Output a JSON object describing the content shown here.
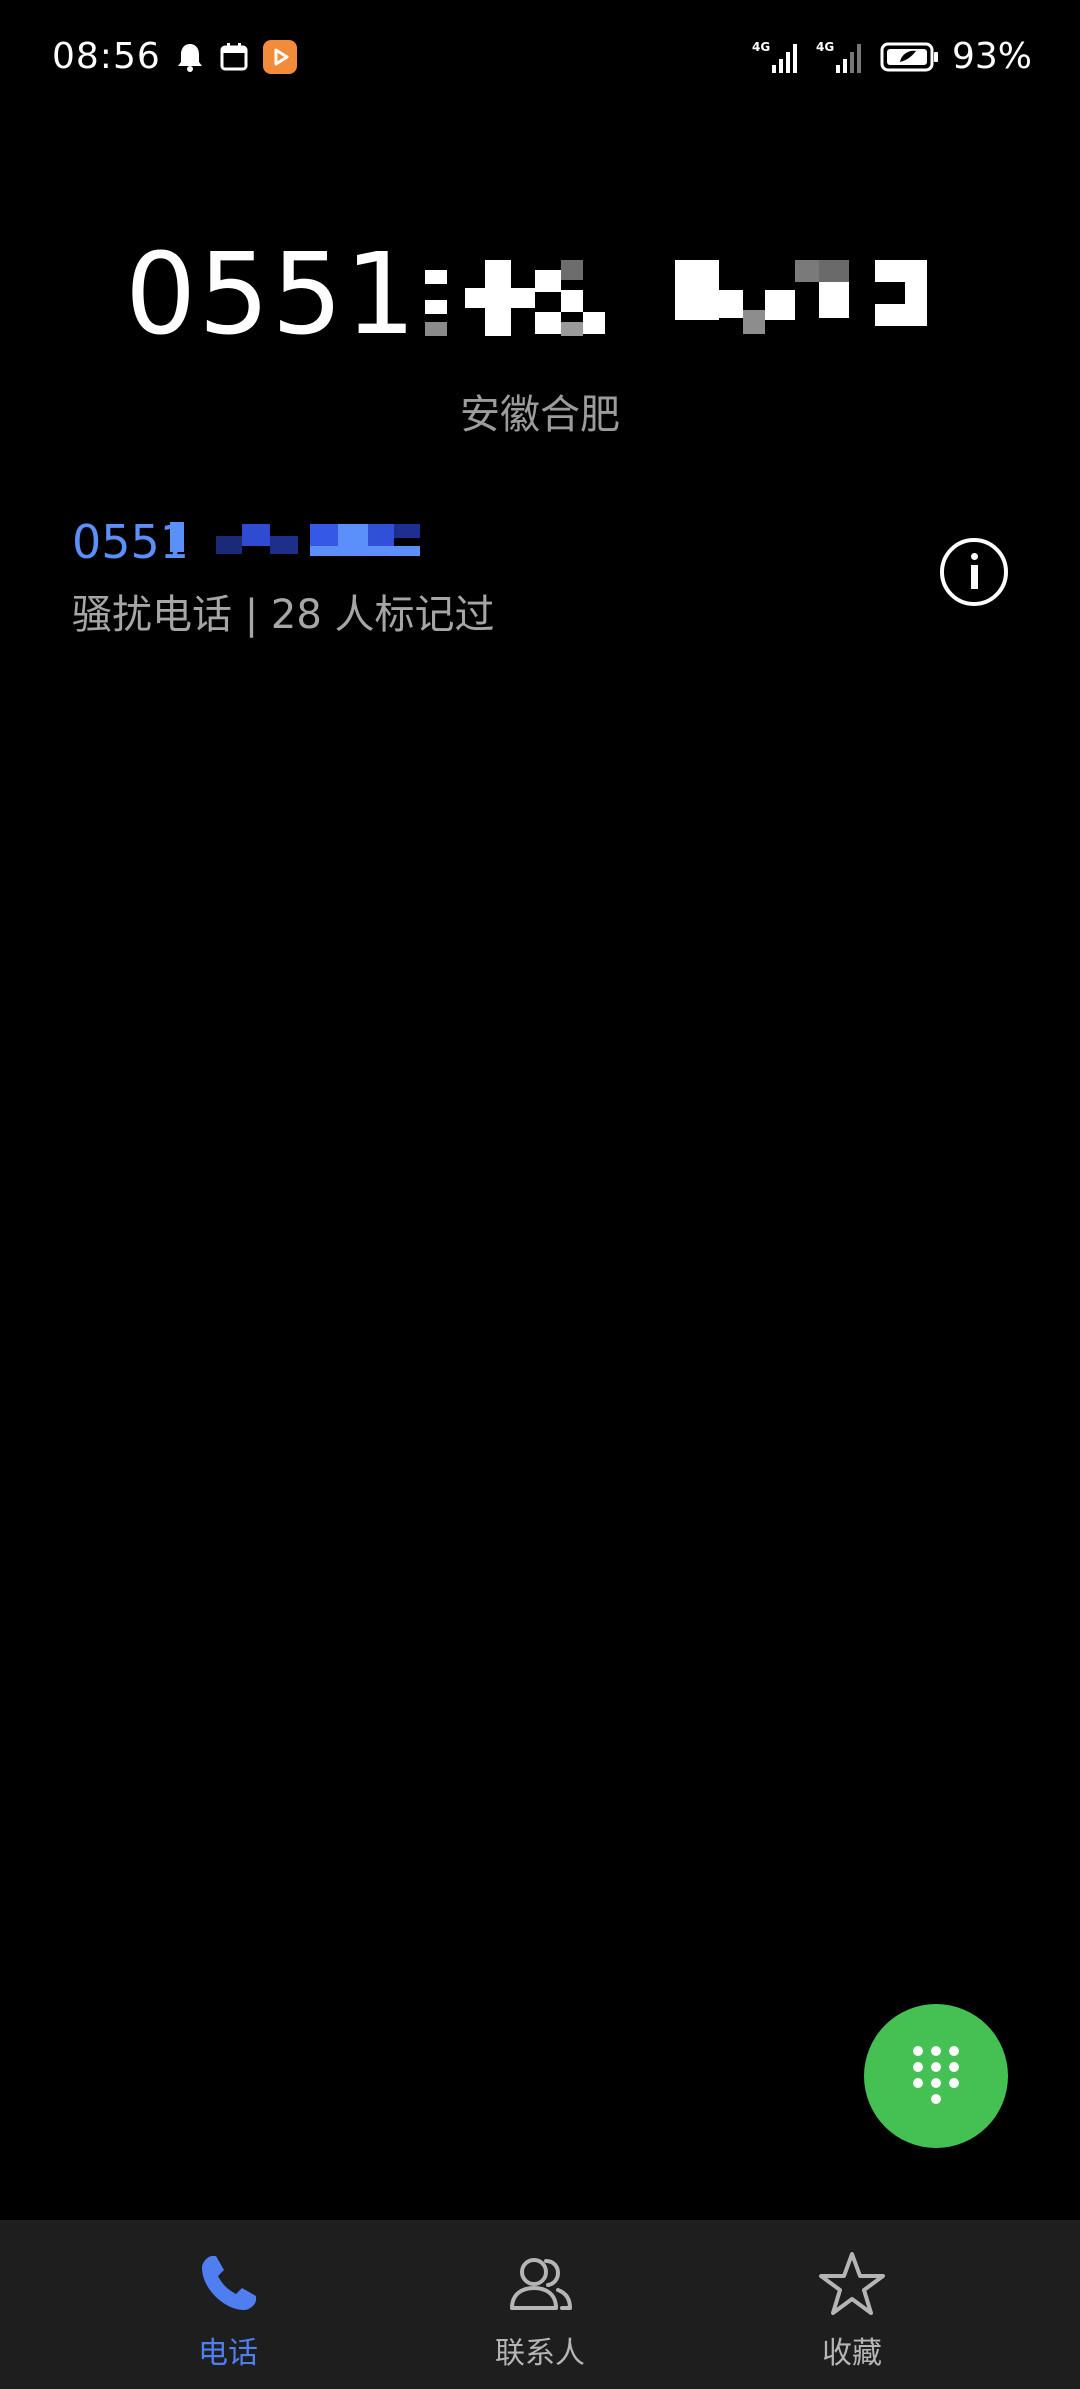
{
  "status_bar": {
    "time": "08:56",
    "network_1": "4G",
    "network_2": "4G",
    "battery_percent": "93%",
    "icons": [
      "bell-icon",
      "calendar-icon",
      "app-badge-icon",
      "signal-icon",
      "signal-icon",
      "battery-icon"
    ]
  },
  "dialed": {
    "number_prefix": "0551",
    "location": "安徽合肥"
  },
  "suggestion": {
    "number_prefix": "0551",
    "tag": "骚扰电话 | 28 人标记过"
  },
  "colors": {
    "accent_blue": "#4f7ef0",
    "suggestion_blue": "#5b8ff9",
    "fab_green": "#44c152",
    "nav_background": "#1e1e1e"
  },
  "nav": {
    "items": [
      {
        "label": "电话",
        "icon": "phone-icon",
        "active": true
      },
      {
        "label": "联系人",
        "icon": "contacts-icon",
        "active": false
      },
      {
        "label": "收藏",
        "icon": "star-icon",
        "active": false
      }
    ]
  }
}
